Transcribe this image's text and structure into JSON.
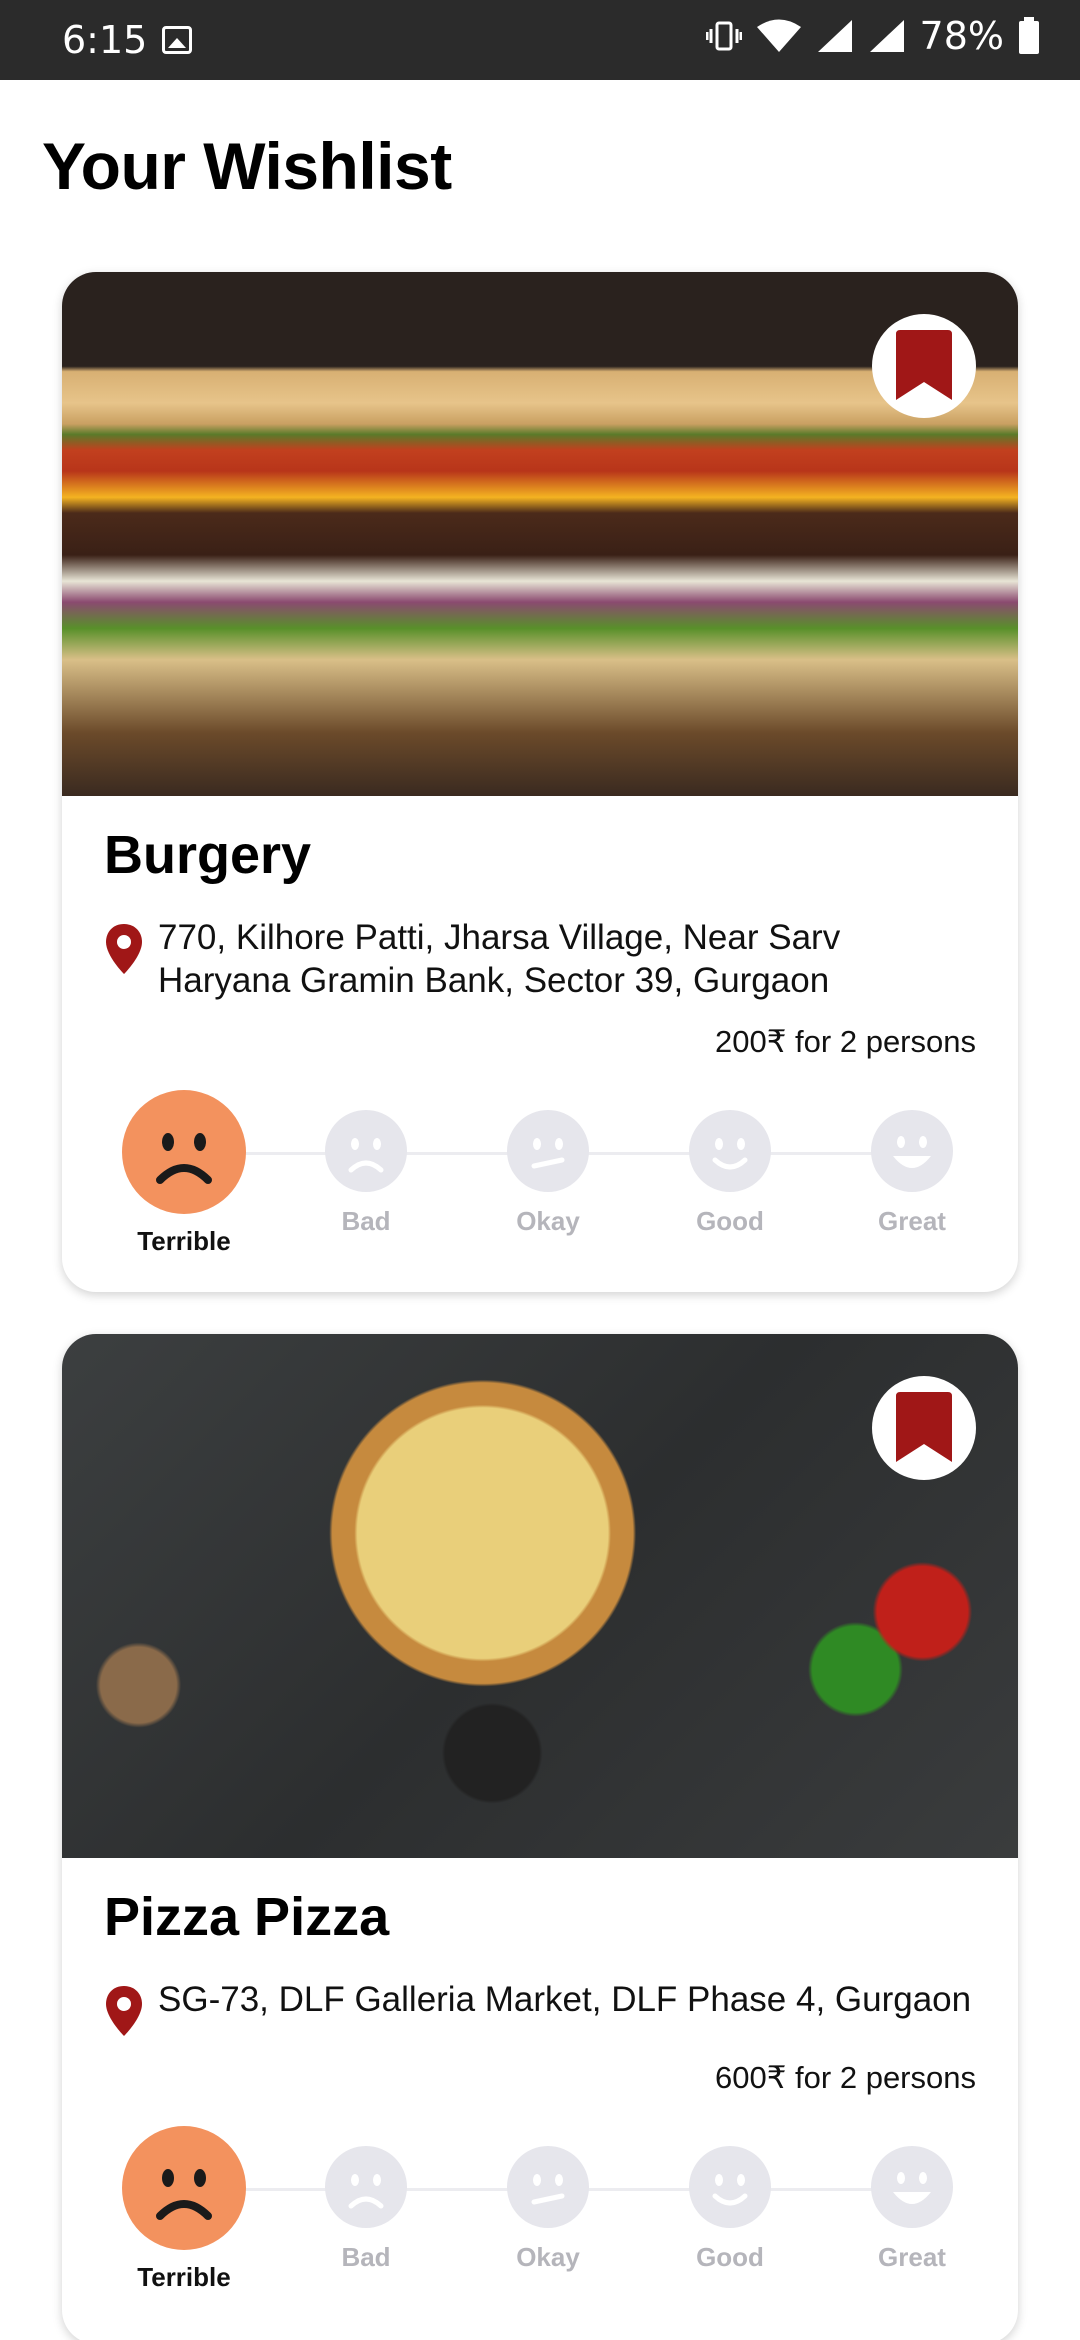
{
  "status_bar": {
    "time": "6:15",
    "battery": "78%"
  },
  "header": {
    "title": "Your Wishlist"
  },
  "colors": {
    "accent_bookmark": "#a01717",
    "terrible_face": "#f3925e",
    "inactive_face": "#e6e6ec"
  },
  "rating_labels": [
    "Terrible",
    "Bad",
    "Okay",
    "Good",
    "Great"
  ],
  "restaurants": [
    {
      "name": "Burgery",
      "address": "770, Kilhore Patti, Jharsa Village, Near Sarv Haryana Gramin Bank, Sector 39, Gurgaon",
      "price": "200₹ for 2 persons",
      "selected_rating": "Terrible",
      "bookmarked": true
    },
    {
      "name": "Pizza Pizza",
      "address": "SG-73, DLF Galleria Market, DLF Phase 4, Gurgaon",
      "price": "600₹ for 2 persons",
      "selected_rating": "Terrible",
      "bookmarked": true
    }
  ]
}
